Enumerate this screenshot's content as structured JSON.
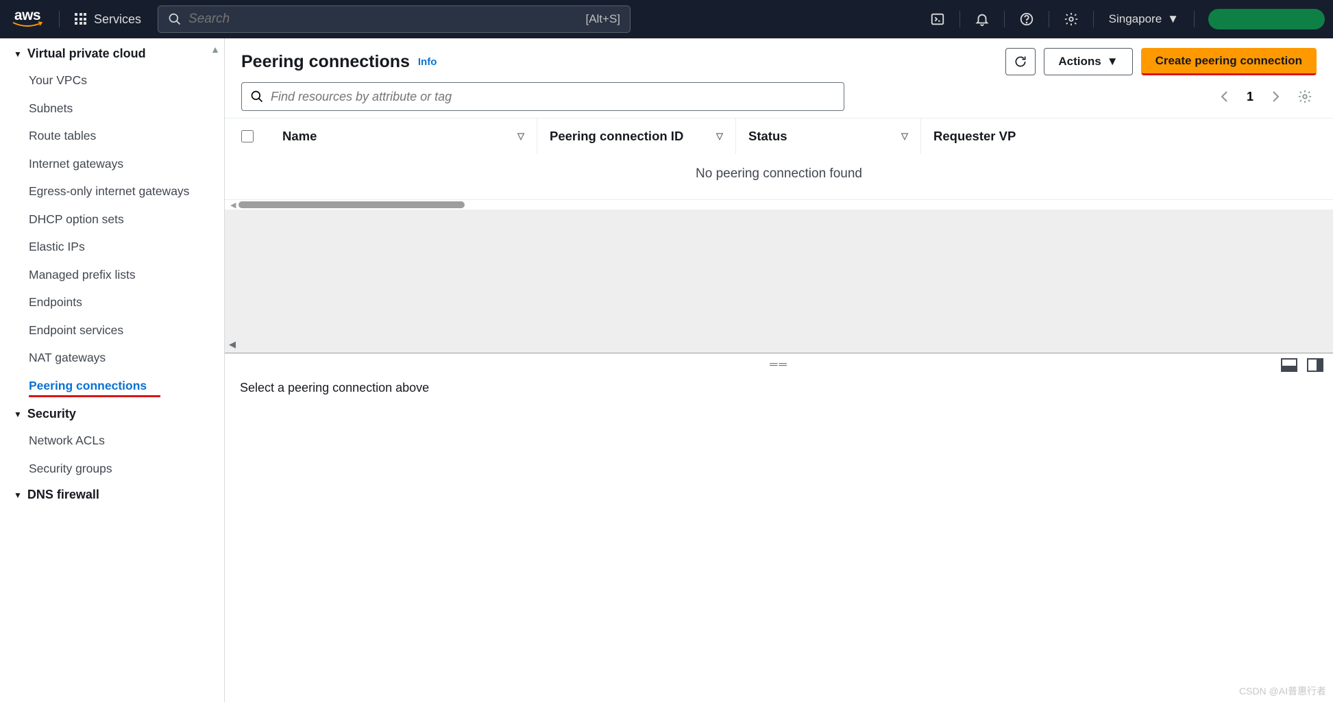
{
  "nav": {
    "services_label": "Services",
    "search_placeholder": "Search",
    "search_shortcut": "[Alt+S]",
    "region": "Singapore"
  },
  "sidebar": {
    "sections": [
      {
        "title": "Virtual private cloud",
        "items": [
          "Your VPCs",
          "Subnets",
          "Route tables",
          "Internet gateways",
          "Egress-only internet gateways",
          "DHCP option sets",
          "Elastic IPs",
          "Managed prefix lists",
          "Endpoints",
          "Endpoint services",
          "NAT gateways",
          "Peering connections"
        ],
        "active_index": 11
      },
      {
        "title": "Security",
        "items": [
          "Network ACLs",
          "Security groups"
        ]
      },
      {
        "title": "DNS firewall",
        "items": []
      }
    ]
  },
  "main": {
    "title": "Peering connections",
    "info_link": "Info",
    "actions_label": "Actions",
    "create_label": "Create peering connection",
    "filter_placeholder": "Find resources by attribute or tag",
    "page_number": "1",
    "columns": [
      "Name",
      "Peering connection ID",
      "Status",
      "Requester VP"
    ],
    "empty_message": "No peering connection found",
    "detail_message": "Select a peering connection above"
  },
  "watermark": "CSDN @AI普惠行者"
}
